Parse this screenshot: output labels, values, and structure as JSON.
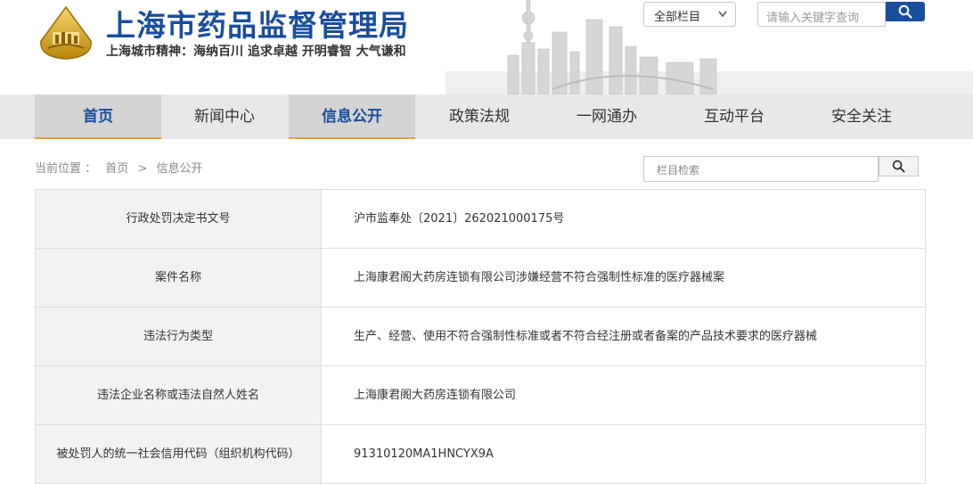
{
  "header": {
    "site_title": "上海市药品监督管理局",
    "slogan": "上海城市精神：海纳百川  追求卓越  开明睿智  大气谦和",
    "category_select": "全部栏目",
    "search_placeholder": "请输入关键字查询"
  },
  "nav": {
    "items": [
      {
        "label": "首页"
      },
      {
        "label": "新闻中心"
      },
      {
        "label": "信息公开"
      },
      {
        "label": "政策法规"
      },
      {
        "label": "一网通办"
      },
      {
        "label": "互动平台"
      },
      {
        "label": "安全关注"
      }
    ]
  },
  "breadcrumb": {
    "prefix": "当前位置 ：",
    "home": "首页",
    "sep": ">",
    "current": "信息公开"
  },
  "column_search": {
    "placeholder": "栏目检索"
  },
  "table": {
    "rows": [
      {
        "label": "行政处罚决定书文号",
        "value": "沪市监奉处〔2021〕262021000175号"
      },
      {
        "label": "案件名称",
        "value": "上海康君阁大药房连锁有限公司涉嫌经营不符合强制性标准的医疗器械案"
      },
      {
        "label": "违法行为类型",
        "value": "生产、经营、使用不符合强制性标准或者不符合经注册或者备案的产品技术要求的医疗器械"
      },
      {
        "label": "违法企业名称或违法自然人姓名",
        "value": "上海康君阁大药房连锁有限公司"
      },
      {
        "label": "被处罚人的统一社会信用代码（组织机构代码）",
        "value": "91310120MA1HNCYX9A"
      }
    ]
  }
}
